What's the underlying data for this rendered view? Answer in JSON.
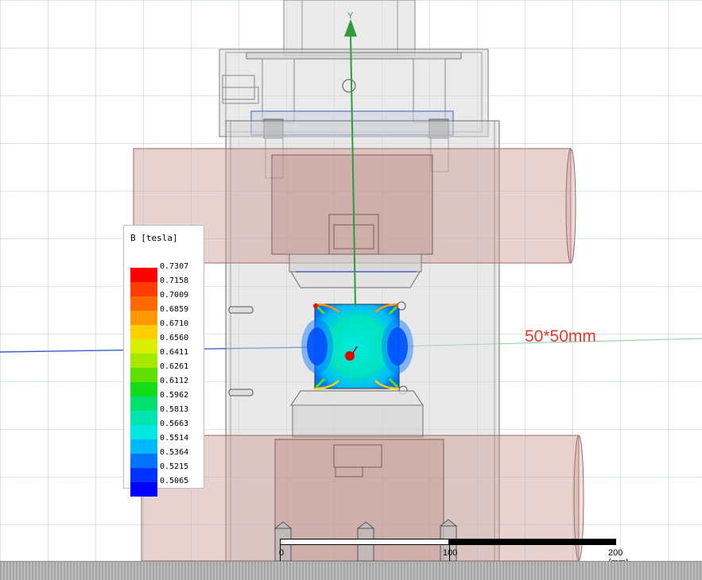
{
  "axis": {
    "y_label": "Y"
  },
  "annotation": {
    "text": "50*50mm",
    "color": "#e53b2f"
  },
  "legend": {
    "title": "B [tesla]",
    "entries": [
      {
        "value": "0.7307",
        "color": "#ff0000"
      },
      {
        "value": "0.7158",
        "color": "#ff3d00"
      },
      {
        "value": "0.7009",
        "color": "#ff6a00"
      },
      {
        "value": "0.6859",
        "color": "#ff9800"
      },
      {
        "value": "0.6710",
        "color": "#ffd000"
      },
      {
        "value": "0.6560",
        "color": "#d9ee00"
      },
      {
        "value": "0.6411",
        "color": "#a6e800"
      },
      {
        "value": "0.6261",
        "color": "#5fe000"
      },
      {
        "value": "0.6112",
        "color": "#13dc1a"
      },
      {
        "value": "0.5962",
        "color": "#00e070"
      },
      {
        "value": "0.5813",
        "color": "#00e4ad"
      },
      {
        "value": "0.5663",
        "color": "#00e8e0"
      },
      {
        "value": "0.5514",
        "color": "#00b8ff"
      },
      {
        "value": "0.5364",
        "color": "#0074ff"
      },
      {
        "value": "0.5215",
        "color": "#0033ff"
      },
      {
        "value": "0.5065",
        "color": "#0000ff"
      }
    ]
  },
  "scale_bar": {
    "labels": [
      "0",
      "100",
      "200 (mm)"
    ]
  }
}
